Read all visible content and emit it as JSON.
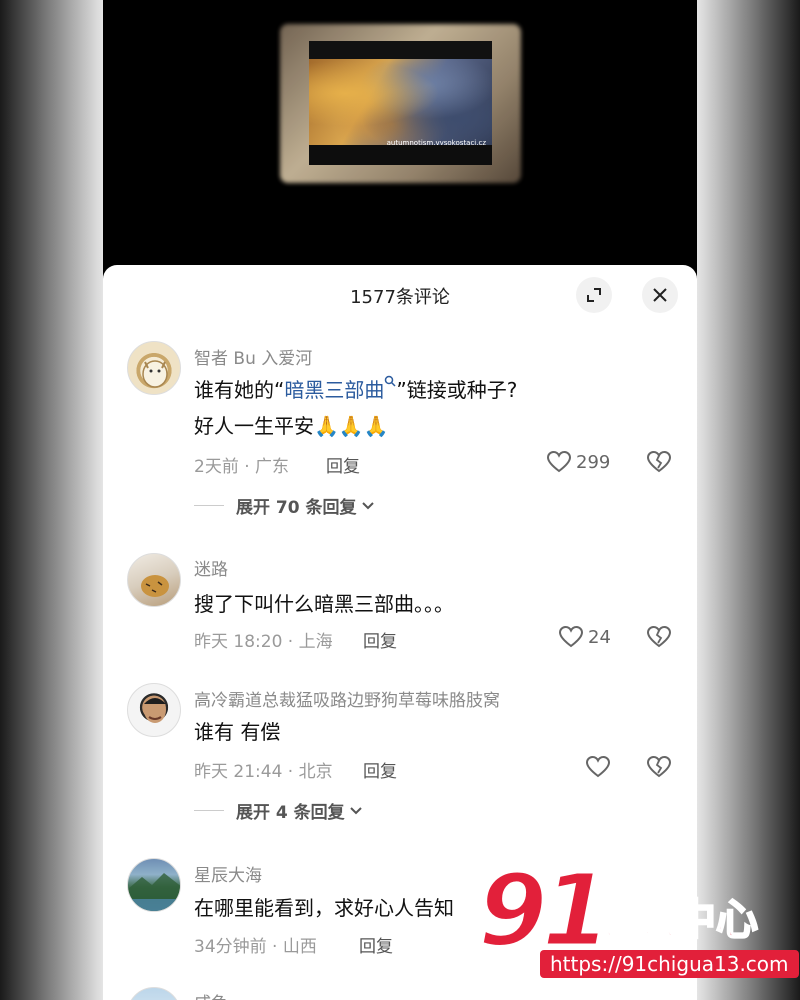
{
  "video": {
    "watermark": "autumnotism.vysokostaci.cz"
  },
  "sheet": {
    "title": "1577条评论"
  },
  "comments": [
    {
      "username": "智者 Bu 入爱河",
      "text_prefix": "谁有她的“",
      "text_keyword": "暗黑三部曲",
      "text_suffix": "”链接或种子?",
      "text_line2": "好人一生平安🙏🙏🙏",
      "meta": "2天前 · 广东",
      "reply_label": "回复",
      "likes": "299",
      "expand_label": "展开 70 条回复"
    },
    {
      "username": "迷路",
      "text": "搜了下叫什么暗黑三部曲。。。",
      "meta": "昨天 18:20 · 上海",
      "reply_label": "回复",
      "likes": "24"
    },
    {
      "username": "高冷霸道总裁猛吸路边野狗草莓味胳肢窝",
      "text": "谁有 有偿",
      "meta": "昨天 21:44 · 北京",
      "reply_label": "回复",
      "likes": "",
      "expand_label": "展开 4 条回复"
    },
    {
      "username": "星辰大海",
      "text": "在哪里能看到，求好心人告知",
      "meta": "34分钟前 · 山西",
      "reply_label": "回复"
    },
    {
      "username": "咸鱼"
    }
  ],
  "watermark_logo": {
    "big": "91",
    "cn": "吃瓜中心",
    "url": "https://91chigua13.com"
  }
}
